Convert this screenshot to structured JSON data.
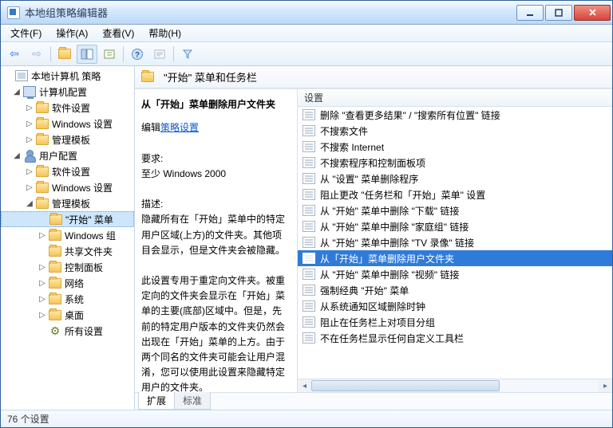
{
  "window": {
    "title": "本地组策略编辑器"
  },
  "menus": {
    "file": "文件(F)",
    "action": "操作(A)",
    "view": "查看(V)",
    "help": "帮助(H)"
  },
  "tree": {
    "root": "本地计算机 策略",
    "computer": {
      "label": "计算机配置",
      "software": "软件设置",
      "windows": "Windows 设置",
      "admin": "管理模板"
    },
    "user": {
      "label": "用户配置",
      "software": "软件设置",
      "windows": "Windows 设置",
      "admin": {
        "label": "管理模板",
        "start": "\"开始\" 菜单",
        "winComp": "Windows 组",
        "shared": "共享文件夹",
        "ctrlPanel": "控制面板",
        "network": "网络",
        "system": "系统",
        "desktop": "桌面",
        "allSettings": "所有设置"
      }
    }
  },
  "path": {
    "title": "\"开始\" 菜单和任务栏"
  },
  "desc": {
    "title": "从「开始」菜单删除用户文件夹",
    "editLabel": "编辑",
    "linkText": "策略设置",
    "reqLabel": "要求:",
    "reqText": "至少 Windows 2000",
    "descLabel": "描述:",
    "p1": "隐藏所有在「开始」菜单中的特定用户区域(上方)的文件夹。其他项目会显示，但是文件夹会被隐藏。",
    "p2": "此设置专用于重定向文件夹。被重定向的文件夹会显示在「开始」菜单的主要(底部)区域中。但是，先前的特定用户版本的文件夹仍然会出现在「开始」菜单的上方。由于两个同名的文件夹可能会让用户混淆，您可以使用此设置来隐藏特定用户的文件夹。"
  },
  "list": {
    "header": "设置",
    "items": [
      "删除 \"查看更多结果\" / \"搜索所有位置\" 链接",
      "不搜索文件",
      "不搜索 Internet",
      "不搜索程序和控制面板项",
      "从 \"设置\" 菜单删除程序",
      "阻止更改 \"任务栏和「开始」菜单\" 设置",
      "从 \"开始\" 菜单中删除 \"下载\" 链接",
      "从 \"开始\" 菜单中删除 \"家庭组\" 链接",
      "从 \"开始\" 菜单中删除 \"TV 录像\" 链接",
      "从「开始」菜单删除用户文件夹",
      "从 \"开始\" 菜单中删除 \"视频\" 链接",
      "强制经典 \"开始\" 菜单",
      "从系统通知区域删除时钟",
      "阻止在任务栏上对项目分组",
      "不在任务栏显示任何自定义工具栏"
    ],
    "selectedIndex": 9
  },
  "tabs": {
    "extended": "扩展",
    "standard": "标准"
  },
  "status": {
    "count": "76 个设置"
  }
}
